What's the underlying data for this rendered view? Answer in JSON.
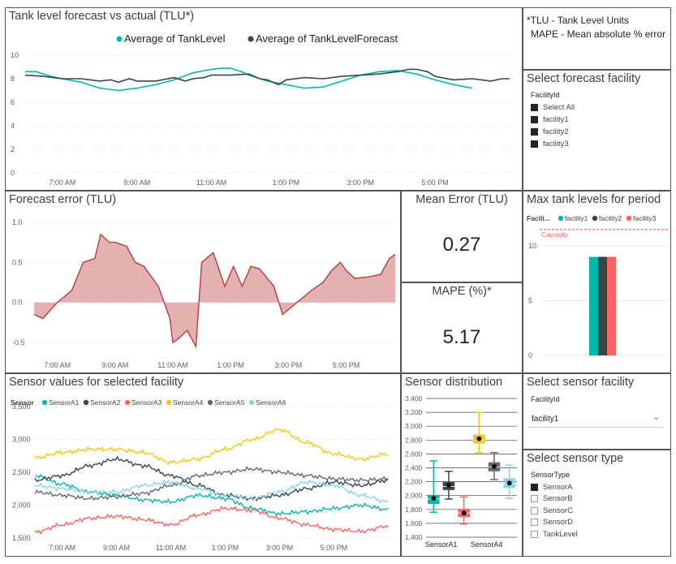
{
  "panels": {
    "tank_forecast": {
      "title": "Tank level forecast vs actual (TLU*)"
    },
    "notes": {
      "line1": "*TLU - Tank Level Units",
      "line2": "MAPE - Mean absolute % error"
    },
    "forecast_facility": {
      "title": "Select forecast facility",
      "header": "FacilityId",
      "items": [
        {
          "label": "Select All",
          "checked": true
        },
        {
          "label": "facility1",
          "checked": true
        },
        {
          "label": "facility2",
          "checked": true
        },
        {
          "label": "facility3",
          "checked": true
        }
      ]
    },
    "forecast_error": {
      "title": "Forecast error (TLU)"
    },
    "mean_error": {
      "title": "Mean Error (TLU)",
      "value": "0.27"
    },
    "mape": {
      "title": "MAPE (%)*",
      "value": "5.17"
    },
    "max_tank": {
      "title": "Max tank levels for period"
    },
    "sensor_values": {
      "title": "Sensor values for selected facility"
    },
    "sensor_distribution": {
      "title": "Sensor distribution"
    },
    "sensor_facility": {
      "title": "Select sensor facility",
      "header": "FacilityId",
      "selected": "facility1"
    },
    "sensor_type": {
      "title": "Select sensor type",
      "header": "SensorType",
      "items": [
        {
          "label": "SensorA",
          "checked": true
        },
        {
          "label": "SensorB",
          "checked": false
        },
        {
          "label": "SensorC",
          "checked": false
        },
        {
          "label": "SensorD",
          "checked": false
        },
        {
          "label": "TankLevel",
          "checked": false
        }
      ]
    }
  },
  "colors": {
    "teal": "#01b8aa",
    "dark": "#374649",
    "red": "#fd625e",
    "yellow": "#f2c80f",
    "gray": "#5f6b6d",
    "lightblue": "#8ad4eb",
    "errfill": "#dea3a3",
    "errline": "#b83c3c"
  },
  "chart_data": [
    {
      "id": "tank_forecast",
      "type": "line",
      "title": "Tank level forecast vs actual (TLU*)",
      "ylim": [
        0,
        10
      ],
      "yticks": [
        0,
        2,
        4,
        6,
        8,
        10
      ],
      "xlim": [
        6.0,
        19.2
      ],
      "xticks": [
        "7:00 AM",
        "9:00 AM",
        "11:00 AM",
        "1:00 PM",
        "3:00 PM",
        "5:00 PM"
      ],
      "grid": true,
      "legend": "top-center",
      "series": [
        {
          "name": "Average of TankLevel",
          "color": "#01b8aa",
          "x": [
            6.0,
            6.3,
            6.7,
            7.0,
            7.5,
            8.0,
            8.5,
            9.0,
            9.5,
            10.0,
            10.5,
            11.0,
            11.3,
            11.5,
            11.8,
            12.0,
            12.5,
            13.0,
            13.5,
            14.0,
            14.5,
            15.0,
            15.5,
            16.0,
            16.5,
            17.0,
            17.5,
            18.0
          ],
          "y": [
            8.6,
            8.6,
            8.2,
            8.0,
            7.7,
            7.2,
            7.0,
            7.2,
            7.5,
            7.9,
            8.5,
            8.8,
            8.9,
            8.9,
            8.6,
            8.3,
            7.8,
            7.5,
            7.2,
            7.3,
            7.8,
            8.3,
            8.6,
            8.7,
            8.4,
            7.9,
            7.5,
            7.2
          ]
        },
        {
          "name": "Average of TankLevelForecast",
          "color": "#374649",
          "x": [
            6.0,
            6.5,
            7.0,
            7.5,
            8.0,
            8.3,
            8.5,
            8.8,
            9.0,
            9.5,
            10.0,
            10.3,
            10.5,
            10.8,
            11.0,
            11.5,
            12.0,
            12.3,
            12.5,
            12.8,
            13.0,
            13.5,
            14.0,
            14.5,
            15.0,
            15.5,
            16.0,
            16.3,
            16.5,
            16.8,
            17.0,
            17.5,
            18.0,
            18.5,
            18.8,
            19.0
          ],
          "y": [
            8.3,
            8.2,
            8.0,
            8.0,
            7.8,
            7.9,
            7.7,
            8.0,
            7.8,
            7.8,
            8.1,
            7.8,
            8.0,
            8.1,
            8.3,
            8.3,
            8.4,
            8.0,
            7.9,
            7.5,
            7.9,
            8.1,
            8.0,
            8.2,
            8.3,
            8.4,
            8.6,
            8.8,
            8.8,
            8.6,
            8.2,
            7.9,
            8.0,
            7.8,
            8.0,
            8.0
          ]
        }
      ]
    },
    {
      "id": "forecast_error",
      "type": "area",
      "title": "Forecast error (TLU)",
      "ylim": [
        -0.6,
        1.1
      ],
      "yticks": [
        -0.5,
        0,
        0.5,
        1.0
      ],
      "ytick_labels": [
        "-0.5",
        "0.0",
        "0.5",
        "1.0"
      ],
      "xlim": [
        6.0,
        18.7
      ],
      "xticks": [
        "7:00 AM",
        "9:00 AM",
        "11:00 AM",
        "1:00 PM",
        "3:00 PM",
        "5:00 PM"
      ],
      "grid": true,
      "series": [
        {
          "name": "",
          "x": [
            6.2,
            6.5,
            7.0,
            7.5,
            7.9,
            8.3,
            8.5,
            8.8,
            9.0,
            9.4,
            9.7,
            10.0,
            10.5,
            10.9,
            11.0,
            11.2,
            11.5,
            11.8,
            12.0,
            12.4,
            12.8,
            13.1,
            13.4,
            13.7,
            14.0,
            14.5,
            14.8,
            15.3,
            15.8,
            16.2,
            16.5,
            16.8,
            17.0,
            17.3,
            17.8,
            18.2,
            18.5,
            18.7
          ],
          "y": [
            -0.15,
            -0.2,
            0.0,
            0.15,
            0.5,
            0.55,
            0.85,
            0.75,
            0.75,
            0.7,
            0.5,
            0.45,
            0.2,
            -0.2,
            -0.5,
            -0.45,
            -0.35,
            -0.55,
            0.5,
            0.62,
            0.2,
            0.45,
            0.2,
            0.45,
            0.42,
            0.2,
            -0.15,
            0.0,
            0.15,
            0.25,
            0.4,
            0.5,
            0.4,
            0.3,
            0.32,
            0.35,
            0.55,
            0.6
          ]
        }
      ]
    },
    {
      "id": "max_tank",
      "type": "bar",
      "title": "Max tank levels for period",
      "ylim": [
        0,
        12
      ],
      "yticks": [
        0,
        5,
        10
      ],
      "legend_label": "Facili...",
      "legend": "top-left",
      "annotation": "Capacity",
      "capacity": 11.5,
      "series": [
        {
          "name": "facility1",
          "values": [
            9
          ],
          "color": "#01b8aa"
        },
        {
          "name": "facility2",
          "values": [
            9
          ],
          "color": "#374649"
        },
        {
          "name": "facility3",
          "values": [
            9
          ],
          "color": "#fd625e"
        }
      ]
    },
    {
      "id": "sensor_values",
      "type": "line",
      "title": "Sensor values for selected facility",
      "ylim": [
        1450,
        3550
      ],
      "yticks": [
        1500,
        2000,
        2500,
        3000,
        3500
      ],
      "ytick_labels": [
        "1,500",
        "2,000",
        "2,500",
        "3,000",
        "3,500"
      ],
      "xlim": [
        6.0,
        19.2
      ],
      "xticks": [
        "7:00 AM",
        "9:00 AM",
        "11:00 AM",
        "1:00 PM",
        "3:00 PM",
        "5:00 PM"
      ],
      "legend_label": "Sensor",
      "legend": "top-left",
      "series": [
        {
          "name": "SensorA1",
          "color": "#01b8aa",
          "x": [
            6,
            7,
            8,
            9,
            10,
            11,
            12,
            13,
            14,
            15,
            16,
            17,
            18,
            19
          ],
          "y": [
            2450,
            2320,
            2200,
            2150,
            2080,
            2050,
            2150,
            2100,
            1950,
            1870,
            1900,
            1950,
            2000,
            1930
          ]
        },
        {
          "name": "SensorA2",
          "color": "#374649",
          "x": [
            6,
            7,
            8,
            9,
            10,
            11,
            12,
            13,
            14,
            15,
            16,
            17,
            18,
            19
          ],
          "y": [
            2380,
            2450,
            2600,
            2700,
            2600,
            2450,
            2300,
            2150,
            2100,
            2150,
            2250,
            2350,
            2300,
            2380
          ]
        },
        {
          "name": "SensorA3",
          "color": "#fd625e",
          "x": [
            6,
            7,
            8,
            9,
            10,
            11,
            12,
            13,
            14,
            15,
            16,
            17,
            18,
            19
          ],
          "y": [
            1590,
            1700,
            1800,
            1830,
            1780,
            1700,
            1850,
            1950,
            1920,
            1800,
            1700,
            1630,
            1600,
            1680
          ]
        },
        {
          "name": "SensorA4",
          "color": "#f2c80f",
          "x": [
            6,
            7,
            8,
            9,
            10,
            11,
            12,
            13,
            14,
            15,
            16,
            17,
            18,
            19
          ],
          "y": [
            2720,
            2800,
            2850,
            2850,
            2800,
            2650,
            2700,
            2850,
            3000,
            3150,
            2950,
            2780,
            2700,
            2780
          ]
        },
        {
          "name": "SensorA5",
          "color": "#5f6b6d",
          "x": [
            6,
            7,
            8,
            9,
            10,
            11,
            12,
            13,
            14,
            15,
            16,
            17,
            18,
            19
          ],
          "y": [
            2200,
            2150,
            2100,
            2130,
            2180,
            2300,
            2450,
            2500,
            2550,
            2500,
            2450,
            2400,
            2380,
            2400
          ]
        },
        {
          "name": "SensorA6",
          "color": "#8ad4eb",
          "x": [
            6,
            7,
            8,
            9,
            10,
            11,
            12,
            13,
            14,
            15,
            16,
            17,
            18,
            19
          ],
          "y": [
            2300,
            2250,
            2200,
            2200,
            2300,
            2350,
            2250,
            2150,
            2100,
            2200,
            2350,
            2300,
            2150,
            2050
          ]
        }
      ]
    },
    {
      "id": "sensor_distribution",
      "type": "box",
      "title": "Sensor distribution",
      "ylim": [
        1400,
        3400
      ],
      "yticks": [
        1400,
        1600,
        1800,
        2000,
        2200,
        2400,
        2600,
        2800,
        3000,
        3200,
        3400
      ],
      "ytick_labels": [
        "1,400",
        "1,600",
        "1,800",
        "2,000",
        "2,200",
        "2,400",
        "2,600",
        "2,800",
        "3,000",
        "3,200",
        "3,400"
      ],
      "categories_shown": [
        "SensorA1",
        "SensorA4"
      ],
      "boxes": [
        {
          "name": "SensorA1",
          "color": "#01b8aa",
          "min": 1760,
          "q1": 1880,
          "median": 1950,
          "mean": 1960,
          "q3": 2010,
          "max": 2500
        },
        {
          "name": "SensorA2",
          "color": "#374649",
          "min": 1950,
          "q1": 2080,
          "median": 2130,
          "mean": 2150,
          "q3": 2200,
          "max": 2350
        },
        {
          "name": "SensorA3",
          "color": "#fd625e",
          "min": 1590,
          "q1": 1690,
          "median": 1750,
          "mean": 1750,
          "q3": 1810,
          "max": 1980
        },
        {
          "name": "SensorA4",
          "color": "#f2c80f",
          "min": 2620,
          "q1": 2750,
          "median": 2800,
          "mean": 2820,
          "q3": 2880,
          "max": 3200
        },
        {
          "name": "SensorA5",
          "color": "#5f6b6d",
          "min": 2230,
          "q1": 2350,
          "median": 2410,
          "mean": 2420,
          "q3": 2480,
          "max": 2620
        },
        {
          "name": "SensorA6",
          "color": "#8ad4eb",
          "min": 1960,
          "q1": 2110,
          "median": 2170,
          "mean": 2180,
          "q3": 2250,
          "max": 2440
        }
      ]
    }
  ]
}
